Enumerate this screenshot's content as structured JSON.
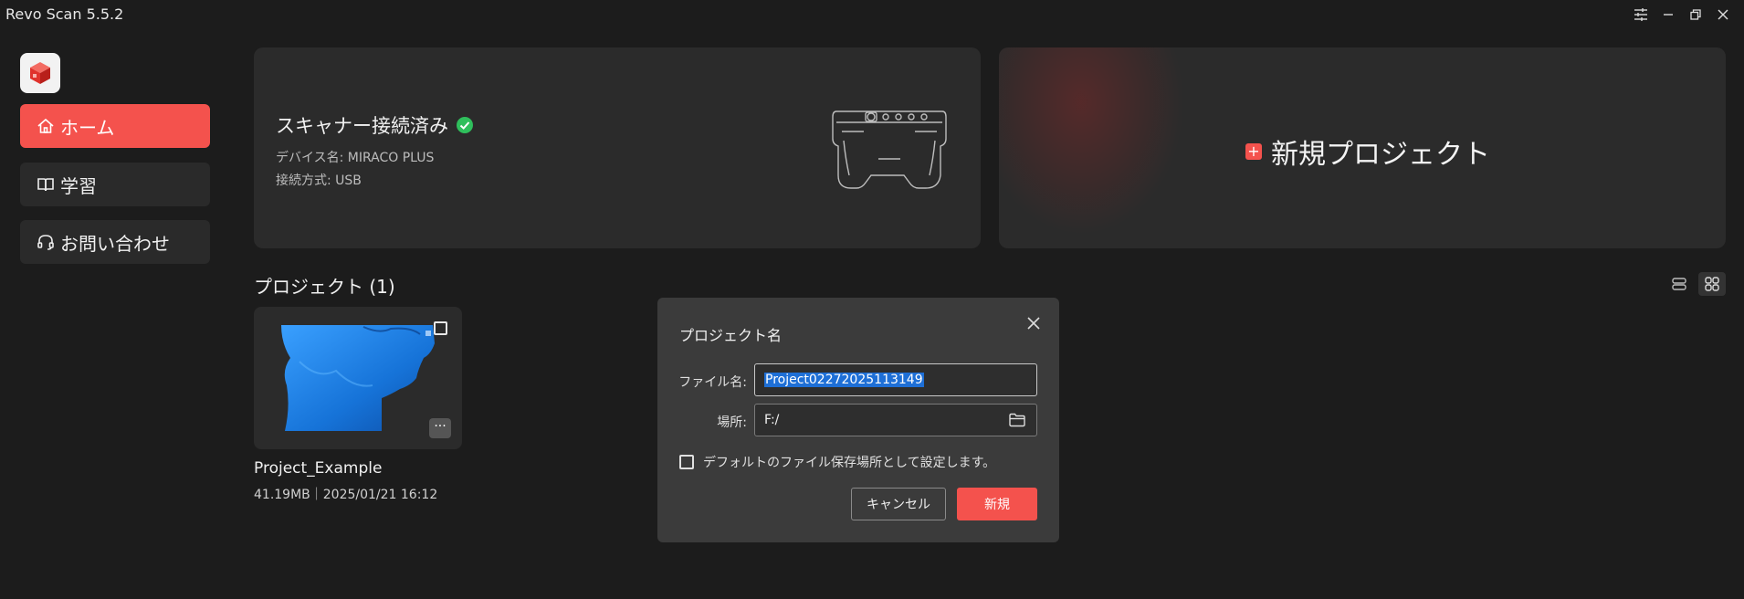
{
  "window": {
    "title": "Revo Scan 5.5.2"
  },
  "sidebar": {
    "items": [
      {
        "label": "ホーム",
        "icon": "home-icon",
        "active": true
      },
      {
        "label": "学習",
        "icon": "book-icon",
        "active": false
      },
      {
        "label": "お問い合わせ",
        "icon": "headset-icon",
        "active": false
      }
    ]
  },
  "scanner": {
    "status": "スキャナー接続済み",
    "device_name": "デバイス名: MIRACO PLUS",
    "connection": "接続方式: USB"
  },
  "new_project": {
    "label": "新規プロジェクト"
  },
  "projects": {
    "heading": "プロジェクト (1)",
    "items": [
      {
        "name": "Project_Example",
        "meta": "41.19MB｜2025/01/21 16:12",
        "more": "···"
      }
    ]
  },
  "dialog": {
    "title": "プロジェクト名",
    "filename_label": "ファイル名:",
    "filename_value": "Project02272025113149",
    "location_label": "場所:",
    "location_value": "F:/",
    "default_checkbox_label": "デフォルトのファイル保存場所として設定します。",
    "cancel_label": "キャンセル",
    "create_label": "新規"
  },
  "colors": {
    "accent": "#f4524d",
    "background": "#1c1c1c",
    "card": "#2b2b2b",
    "dialog": "#3b3b3b",
    "success": "#2fbf5c",
    "selection": "#1e6fd6"
  }
}
